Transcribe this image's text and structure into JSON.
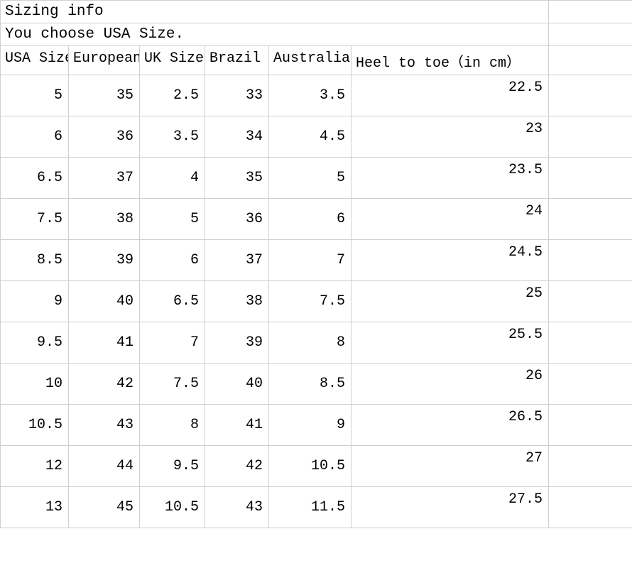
{
  "title": "Sizing info",
  "subtitle": "You choose USA Size.",
  "columns": [
    "USA Size",
    "European",
    "UK Size",
    "Brazil",
    "Australia",
    "Heel to toe（in cm）"
  ],
  "rows": [
    {
      "usa": "5",
      "european": "35",
      "uk": "2.5",
      "brazil": "33",
      "australia": "3.5",
      "heel_to_toe": "22.5"
    },
    {
      "usa": "6",
      "european": "36",
      "uk": "3.5",
      "brazil": "34",
      "australia": "4.5",
      "heel_to_toe": "23"
    },
    {
      "usa": "6.5",
      "european": "37",
      "uk": "4",
      "brazil": "35",
      "australia": "5",
      "heel_to_toe": "23.5"
    },
    {
      "usa": "7.5",
      "european": "38",
      "uk": "5",
      "brazil": "36",
      "australia": "6",
      "heel_to_toe": "24"
    },
    {
      "usa": "8.5",
      "european": "39",
      "uk": "6",
      "brazil": "37",
      "australia": "7",
      "heel_to_toe": "24.5"
    },
    {
      "usa": "9",
      "european": "40",
      "uk": "6.5",
      "brazil": "38",
      "australia": "7.5",
      "heel_to_toe": "25"
    },
    {
      "usa": "9.5",
      "european": "41",
      "uk": "7",
      "brazil": "39",
      "australia": "8",
      "heel_to_toe": "25.5"
    },
    {
      "usa": "10",
      "european": "42",
      "uk": "7.5",
      "brazil": "40",
      "australia": "8.5",
      "heel_to_toe": "26"
    },
    {
      "usa": "10.5",
      "european": "43",
      "uk": "8",
      "brazil": "41",
      "australia": "9",
      "heel_to_toe": "26.5"
    },
    {
      "usa": "12",
      "european": "44",
      "uk": "9.5",
      "brazil": "42",
      "australia": "10.5",
      "heel_to_toe": "27"
    },
    {
      "usa": "13",
      "european": "45",
      "uk": "10.5",
      "brazil": "43",
      "australia": "11.5",
      "heel_to_toe": "27.5"
    }
  ]
}
